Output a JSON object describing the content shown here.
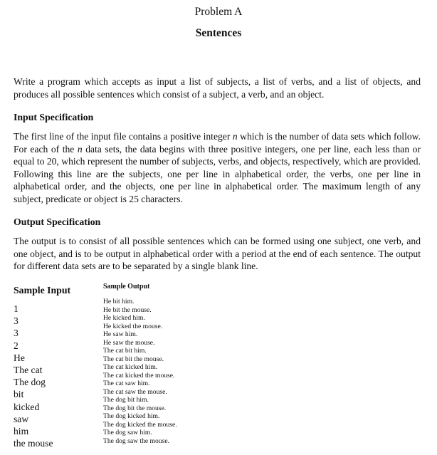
{
  "problem_label": "Problem A",
  "problem_name": "Sentences",
  "intro": "Write a program which accepts as input a list of subjects, a list of verbs, and a list of objects, and produces all possible sentences which consist of a subject, a verb, and an object.",
  "input_spec": {
    "heading": "Input Specification",
    "text_a": "The first line of the input file contains a positive integer ",
    "var_n": "n",
    "text_b": " which is the number of data sets which follow.  For each of the ",
    "text_c": " data sets, the data begins with three positive integers, one per line, each less than or equal to 20, which represent the number of subjects, verbs, and objects, respectively, which are provided.  Following this line are the subjects, one per line in alphabetical order, the verbs, one per line in alphabetical order, and the objects, one per line in alphabetical order.  The maximum length of any subject, predicate or object is 25 characters."
  },
  "output_spec": {
    "heading": "Output Specification",
    "text": "The output is to consist of all possible sentences which can be formed using one subject, one verb, and one object, and is to be output in alphabetical order with a period at the end of each sentence.  The output for different data sets are to be separated by a single blank line."
  },
  "sample_input": {
    "heading": "Sample Input",
    "lines": [
      "1",
      "3",
      "3",
      "2",
      "He",
      "The cat",
      "The dog",
      "bit",
      "kicked",
      "saw",
      "him",
      "the mouse"
    ]
  },
  "sample_output": {
    "heading": "Sample Output",
    "lines": [
      "He bit him.",
      "He bit the mouse.",
      "He kicked him.",
      "He kicked the mouse.",
      "He saw him.",
      "He saw the mouse.",
      "The cat bit him.",
      "The cat bit the mouse.",
      "The cat kicked him.",
      "The cat kicked the mouse.",
      "The cat saw him.",
      "The cat saw the mouse.",
      "The dog bit him.",
      "The dog bit the mouse.",
      "The dog kicked him.",
      "The dog kicked the mouse.",
      "The dog saw him.",
      "The dog saw the mouse."
    ]
  }
}
